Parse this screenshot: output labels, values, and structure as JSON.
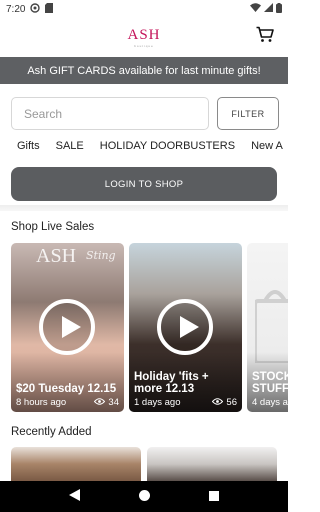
{
  "status_bar": {
    "time": "7:20"
  },
  "header": {
    "logo": "ASH",
    "logo_sub": "boutique"
  },
  "banner": {
    "text": "Ash GIFT CARDS available for last minute gifts!"
  },
  "search": {
    "placeholder": "Search",
    "filter_label": "FILTER"
  },
  "categories": [
    "Gifts",
    "SALE",
    "HOLIDAY DOORBUSTERS",
    "New A"
  ],
  "login": {
    "label": "LOGIN TO SHOP"
  },
  "live_sales": {
    "title": "Shop Live Sales",
    "cards": [
      {
        "title": "$20 Tuesday 12.15",
        "time": "8 hours ago",
        "views": "34",
        "overlay_logo": "ASH",
        "overlay_script": "Sting"
      },
      {
        "title": "Holiday 'fits + more 12.13",
        "time": "1 days ago",
        "views": "56"
      },
      {
        "title": "STOCK STUFFE",
        "time": "4 days a"
      }
    ]
  },
  "recently_added": {
    "title": "Recently Added"
  },
  "colors": {
    "brand": "#c4145a",
    "banner_bg": "#5e6063",
    "login_bg": "#5b5d60"
  }
}
